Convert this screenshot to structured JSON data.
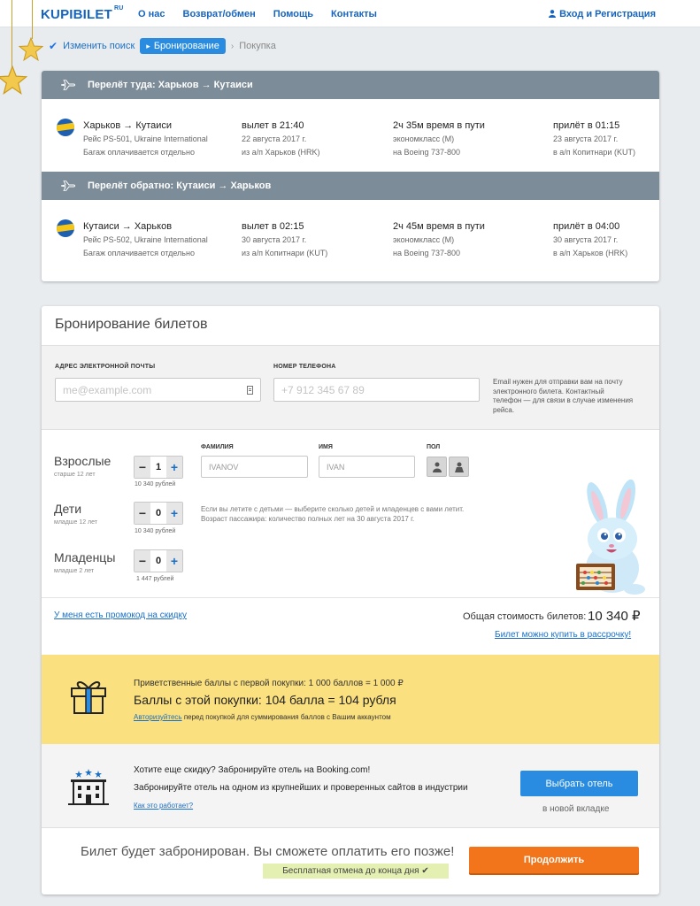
{
  "header": {
    "logo": "KUPIBILET",
    "logo_suffix": "RU",
    "nav": [
      "О нас",
      "Возврат/обмен",
      "Помощь",
      "Контакты"
    ],
    "login": "Вход и Регистрация"
  },
  "breadcrumbs": {
    "change_search": "Изменить поиск",
    "booking": "Бронирование",
    "purchase": "Покупка"
  },
  "flights": [
    {
      "header": "Перелёт туда: Харьков → Кутаиси",
      "route": "Харьков → Кутаиси",
      "flight": "Рейс PS-501, Ukraine International",
      "baggage": "Багаж оплачивается отдельно",
      "departure": "вылет в 21:40",
      "dep_date": "22 августа 2017 г.",
      "dep_airport": "из а/п Харьков (HRK)",
      "duration": "2ч 35м время в пути",
      "class": "экономкласс (M)",
      "aircraft": "на Boeing 737-800",
      "arrival": "прилёт в 01:15",
      "arr_date": "23 августа 2017 г.",
      "arr_airport": "в а/п Копитнари (KUT)"
    },
    {
      "header": "Перелёт обратно: Кутаиси → Харьков",
      "route": "Кутаиси → Харьков",
      "flight": "Рейс PS-502, Ukraine International",
      "baggage": "Багаж оплачивается отдельно",
      "departure": "вылет в 02:15",
      "dep_date": "30 августа 2017 г.",
      "dep_airport": "из а/п Копитнари (KUT)",
      "duration": "2ч 45м время в пути",
      "class": "экономкласс (M)",
      "aircraft": "на Boeing 737-800",
      "arrival": "прилёт в 04:00",
      "arr_date": "30 августа 2017 г.",
      "arr_airport": "в а/п Харьков (HRK)"
    }
  ],
  "booking": {
    "title": "Бронирование билетов",
    "email_label": "АДРЕС ЭЛЕКТРОННОЙ ПОЧТЫ",
    "email_placeholder": "me@example.com",
    "phone_label": "НОМЕР ТЕЛЕФОНА",
    "phone_placeholder": "+7 912 345 67 89",
    "contact_hint": "Email нужен для отправки вам на почту электронного билета. Контактный телефон — для связи в случае изменения рейса.",
    "col_lastname": "ФАМИЛИЯ",
    "col_firstname": "ИМЯ",
    "col_gender": "ПОЛ",
    "passengers": [
      {
        "label": "Взрослые",
        "sub": "старше 12 лет",
        "count": "1",
        "price": "10 340 рублей"
      },
      {
        "label": "Дети",
        "sub": "младше 12 лет",
        "count": "0",
        "price": "10 340 рублей"
      },
      {
        "label": "Младенцы",
        "sub": "младше 2 лет",
        "count": "0",
        "price": "1 447 рублей"
      }
    ],
    "lastname_value": "IVANOV",
    "firstname_value": "IVAN",
    "kids_hint_1": "Если вы летите с детьми — выберите сколько детей и младенцев с вами летит.",
    "kids_hint_2": "Возраст пассажира: количество полных лет на 30 августа 2017 г.",
    "promo": "У меня есть промокод на скидку",
    "total_label": "Общая стоимость билетов:",
    "total_value": "10 340 ₽",
    "installment": "Билет можно купить в рассрочку!"
  },
  "bonus": {
    "line1": "Приветственные баллы с первой покупки: 1 000 баллов = 1 000 ₽",
    "line2": "Баллы с этой покупки: 104 балла = 104 рубля",
    "login_link": "Авторизуйтесь",
    "line3_rest": " перед покупкой для суммирования баллов с Вашим аккаунтом"
  },
  "hotel": {
    "line1": "Хотите еще скидку? Забронируйте отель на Booking.com!",
    "line2": "Забронируйте отель на одном из крупнейших и проверенных сайтов в индустрии",
    "how": "Как это работает?",
    "button": "Выбрать отель",
    "new_tab": "в новой вкладке"
  },
  "bottom": {
    "message": "Билет будет забронирован. Вы сможете оплатить его позже!",
    "free_cancel": "Бесплатная отмена до конца дня ✔",
    "continue": "Продолжить"
  },
  "colors": {
    "brand": "#1565c0",
    "flight_header": "#7d8c99",
    "bonus_bg": "#fbe07f",
    "primary_button": "#2a8ce0",
    "continue_button": "#f2751b"
  }
}
